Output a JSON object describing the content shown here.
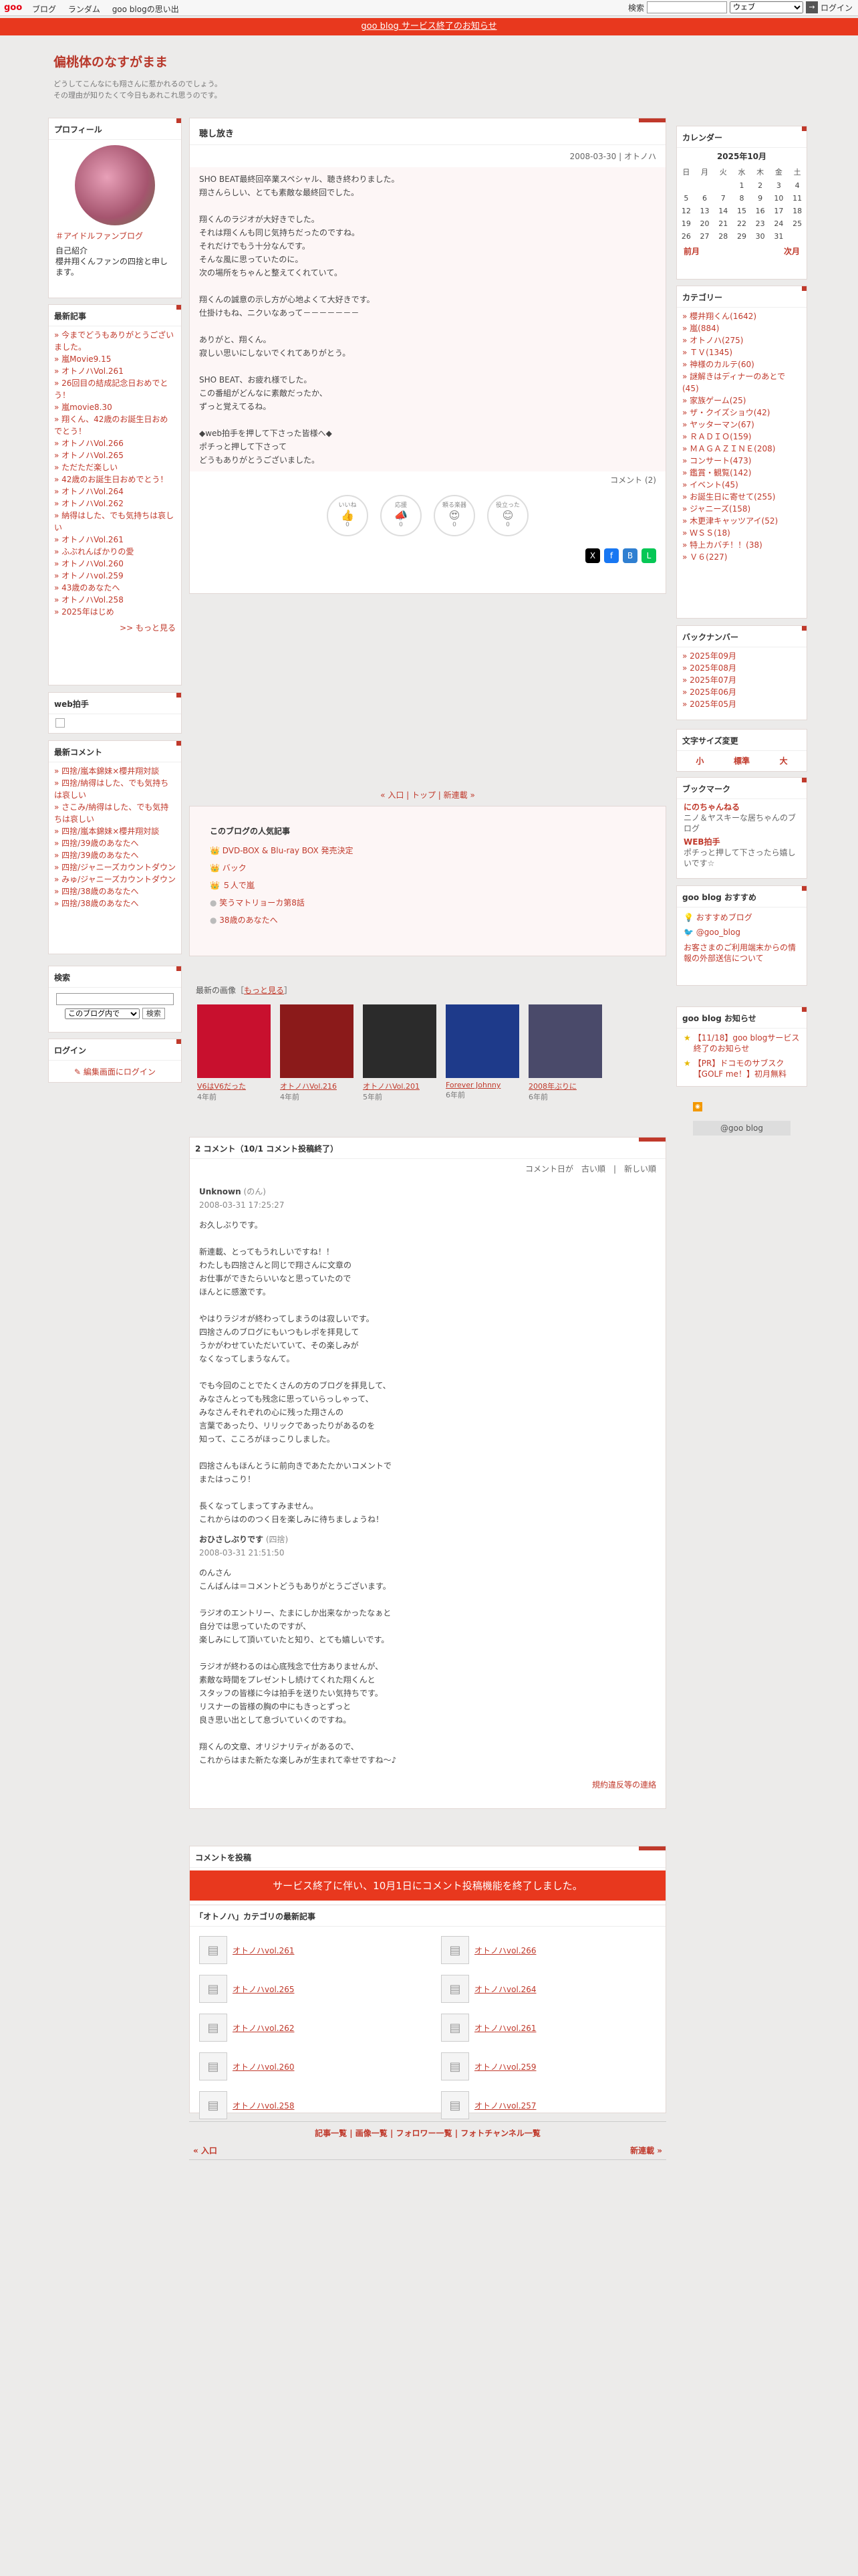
{
  "topbar": {
    "logo": "goo",
    "nav": [
      "ブログ",
      "ランダム",
      "goo blogの思い出"
    ],
    "search_label": "検索",
    "search_select": "ウェブ",
    "login": "ログイン"
  },
  "notice": "goo blog サービス終了のお知らせ",
  "header": {
    "title": "偏桃体のなすがまま",
    "desc1": "どうしてこんなにも翔さんに惹かれるのでしょう。",
    "desc2": "その理由が知りたくて今日もあれこれ思うのです。"
  },
  "profile": {
    "title": "プロフィール",
    "tag": "＃アイドルファンブログ",
    "intro_label": "自己紹介",
    "intro": "櫻井翔くんファンの四捨と申します。"
  },
  "recent": {
    "title": "最新記事",
    "items": [
      "今までどうもありがとうございました。",
      "嵐Movie9.15",
      "オトノハVol.261",
      "26回目の結成記念日おめでとう！",
      "嵐movie8.30",
      "翔くん、42歳のお誕生日おめでとう！",
      "オトノハVol.266",
      "オトノハVol.265",
      "ただただ楽しい",
      "42歳のお誕生日おめでとう！",
      "オトノハVol.264",
      "オトノハVol.262",
      "納得はした、でも気持ちは哀しい",
      "オトノハVol.261",
      "ふぶれんばかりの愛",
      "オトノハVol.260",
      "オトノハvol.259",
      "43歳のあなたへ",
      "オトノハVol.258",
      "2025年はじめ"
    ],
    "more": ">> もっと見る"
  },
  "clap": {
    "title": "web拍手"
  },
  "recent_comments": {
    "title": "最新コメント",
    "items": [
      "四捨/嵐本錦妹×櫻井翔対談",
      "四捨/納得はした、でも気持ちは哀しい",
      "さこみ/納得はした、でも気持ちは哀しい",
      "四捨/嵐本錦妹×櫻井翔対談",
      "四捨/39歳のあなたへ",
      "四捨/39歳のあなたへ",
      "四捨/ジャニーズカウントダウン",
      "みゅ/ジャニーズカウントダウン",
      "四捨/38歳のあなたへ",
      "四捨/38歳のあなたへ"
    ]
  },
  "search": {
    "title": "検索",
    "select": "このブログ内で",
    "button": "検索"
  },
  "login": {
    "title": "ログイン",
    "link": "編集画面にログイン"
  },
  "article": {
    "title": "聴し放き",
    "meta": "2008-03-30 | オトノハ",
    "body": "SHO BEAT最終回卒業スペシャル、聴き終わりました。\n翔さんらしい、とても素敵な最終回でした。\n\n翔くんのラジオが大好きでした。\nそれは翔くんも同じ気持ちだったのですね。\nそれだけでもう十分なんです。\nそんな風に思っていたのに。\n次の場所をちゃんと整えてくれていて。\n\n翔くんの誠意の示し方が心地よくて大好きです。\n仕掛けもね、ニクいなあって－－－－－－－\n\nありがと、翔くん。\n寂しい思いにしないでくれてありがとう。\n\nSHO BEAT、お疲れ様でした。\nこの番組がどんなに素敵だったか、\nずっと覚えてるね。\n\n◆web拍手を押して下さった皆様へ◆\nポチっと押して下さって\nどうもありがとうございました。",
    "comment_count": "コメント (2)",
    "reactions": [
      {
        "label": "いいね",
        "icon": "👍",
        "count": "0"
      },
      {
        "label": "応援",
        "icon": "📣",
        "count": "0"
      },
      {
        "label": "頼る楽器",
        "icon": "😍",
        "count": "0"
      },
      {
        "label": "役立った",
        "icon": "😊",
        "count": "0"
      }
    ]
  },
  "pager": "« 入口 | トップ | 新連載 »",
  "popular": {
    "title": "このブログの人気記事",
    "items": [
      "DVD-BOX & Blu-ray BOX 発売決定",
      "バック",
      "５人で嵐",
      "笑うマトリョーカ第8話",
      "38歳のあなたへ"
    ]
  },
  "images": {
    "title": "最新の画像",
    "more": "もっと見る",
    "items": [
      {
        "label": "V6はV6だった",
        "date": "4年前"
      },
      {
        "label": "オトノハVol.216",
        "date": "4年前"
      },
      {
        "label": "オトノハVol.201",
        "date": "5年前"
      },
      {
        "label": "Forever Johnny",
        "date": "6年前"
      },
      {
        "label": "2008年ぶりに",
        "date": "6年前"
      }
    ]
  },
  "comments": {
    "title": "2 コメント（10/1 コメント投稿終了）",
    "sort": "コメント日が　古い順　|　新しい順",
    "c1_name": "Unknown",
    "c1_suffix": "(のん)",
    "c1_date": "2008-03-31 17:25:27",
    "c1_body": "お久しぶりです。\n\n新連載、とってもうれしいですね！！\nわたしも四捨さんと同じで翔さんに文章の\nお仕事ができたらいいなと思っていたので\nほんとに感激です。\n\nやはりラジオが終わってしまうのは寂しいです。\n四捨さんのブログにもいつもレポを拝見して\nうかがわせていただいていて、その楽しみが\nなくなってしまうなんて。\n\nでも今回のことでたくさんの方のブログを拝見して、\nみなさんとっても残念に思っていらっしゃって、\nみなさんそれぞれの心に残った翔さんの\n言葉であったり、リリックであったりがあるのを\n知って、こころがほっこりしました。\n\n四捨さんもほんとうに前向きであたたかいコメントで\nまたはっこり！\n\n長くなってしまってすみません。\nこれからはののつく日を楽しみに待ちましょうね！",
    "c2_name": "おひさしぶりです",
    "c2_suffix": "(四捨)",
    "c2_date": "2008-03-31 21:51:50",
    "c2_body": "のんさん\nこんばんは＝コメントどうもありがとうございます。\n\nラジオのエントリー、たまにしか出来なかったなぁと\n自分では思っていたのですが、\n楽しみにして頂いていたと知り、とても嬉しいです。\n\nラジオが終わるのは心底残念で仕方ありませんが、\n素敵な時間をプレゼントし続けてくれた翔くんと\nスタッフの皆様に今は拍手を送りたい気持ちです。\nリスナーの皆様の胸の中にもきっとずっと\n良き思い出として息づいていくのですね。\n\n翔くんの文章、オリジナリティがあるので、\nこれからはまた新たな楽しみが生まれて幸せですね〜♪",
    "report": "規約違反等の連絡"
  },
  "post_comment": {
    "title": "コメントを投稿",
    "notice": "サービス終了に伴い、10月1日にコメント投稿機能を終了しました。"
  },
  "category_latest": {
    "title": "「オトノハ」カテゴリの最新記事",
    "items": [
      "オトノハvol.261",
      "オトノハvol.266",
      "オトノハvol.265",
      "オトノハvol.264",
      "オトノハvol.262",
      "オトノハvol.261",
      "オトノハvol.260",
      "オトノハvol.259",
      "オトノハvol.258",
      "オトノハvol.257"
    ]
  },
  "footer_links": "記事一覧 | 画像一覧 | フォロワー一覧 | フォトチャンネル一覧",
  "footer_prev": "« 入口",
  "footer_next": "新連載 »",
  "calendar": {
    "title": "カレンダー",
    "month": "2025年10月",
    "days": [
      "日",
      "月",
      "火",
      "水",
      "木",
      "金",
      "土"
    ],
    "rows": [
      [
        "",
        "",
        "",
        "1",
        "2",
        "3",
        "4"
      ],
      [
        "5",
        "6",
        "7",
        "8",
        "9",
        "10",
        "11"
      ],
      [
        "12",
        "13",
        "14",
        "15",
        "16",
        "17",
        "18"
      ],
      [
        "19",
        "20",
        "21",
        "22",
        "23",
        "24",
        "25"
      ],
      [
        "26",
        "27",
        "28",
        "29",
        "30",
        "31",
        ""
      ]
    ],
    "prev": "前月",
    "next": "次月"
  },
  "categories": {
    "title": "カテゴリー",
    "items": [
      "櫻井翔くん(1642)",
      "嵐(884)",
      "オトノハ(275)",
      "ＴＶ(1345)",
      "神様のカルテ(60)",
      "謎解きはディナーのあとで(45)",
      "家族ゲーム(25)",
      "ザ・クイズショウ(42)",
      "ヤッターマン(67)",
      "ＲＡＤＩＯ(159)",
      "ＭＡＧＡＺＩＮＥ(208)",
      "コンサート(473)",
      "鑑賞・観覧(142)",
      "イベント(45)",
      "お誕生日に寄せて(255)",
      "ジャニーズ(158)",
      "木更津キャッツアイ(52)",
      "ＷＳＳ(18)",
      "特上カバチ！！(38)",
      "Ｖ６(227)"
    ]
  },
  "backnumber": {
    "title": "バックナンバー",
    "items": [
      "2025年09月",
      "2025年08月",
      "2025年07月",
      "2025年06月",
      "2025年05月"
    ]
  },
  "fontsize": {
    "title": "文字サイズ変更",
    "small": "小",
    "normal": "標準",
    "large": "大"
  },
  "bookmark": {
    "title": "ブックマーク",
    "b1": "にのちゃんねる",
    "b1_desc": "ニノ＆ヤスキーな居ちゃんのブログ",
    "b2": "WEB拍手",
    "b2_desc": "ポチっと押して下さったら嬉しいです☆"
  },
  "goo_recommend": {
    "title": "goo blog おすすめ",
    "r1": "おすすめブログ",
    "r2": "@goo_blog",
    "r3": "お客さまのご利用端末からの情報の外部送信について"
  },
  "goo_notice": {
    "title": "goo blog お知らせ",
    "n1": "【11/18】goo blogサービス終了のお知らせ",
    "n2": "【PR】ドコモのサブスク【GOLF me！】初月無料"
  },
  "footer_logo": "@goo blog"
}
